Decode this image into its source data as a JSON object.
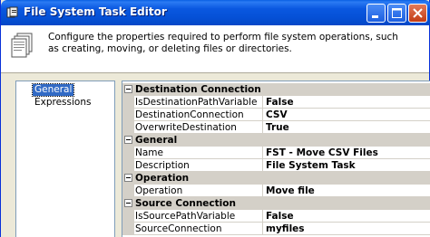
{
  "window": {
    "title": "File System Task Editor",
    "controls": {
      "minimize": "minimize-icon",
      "maximize": "maximize-icon",
      "close": "close-icon"
    }
  },
  "header": {
    "description": "Configure the properties required to perform file system operations, such as creating, moving, or deleting files or directories.",
    "icon": "documents-stack-icon"
  },
  "nav": {
    "items": [
      {
        "label": "General",
        "selected": true
      },
      {
        "label": "Expressions",
        "selected": false
      }
    ]
  },
  "grid": {
    "categories": [
      {
        "label": "Destination Connection",
        "rows": [
          {
            "name": "IsDestinationPathVariable",
            "value": "False"
          },
          {
            "name": "DestinationConnection",
            "value": "CSV"
          },
          {
            "name": "OverwriteDestination",
            "value": "True"
          }
        ]
      },
      {
        "label": "General",
        "rows": [
          {
            "name": "Name",
            "value": "FST - Move CSV Files"
          },
          {
            "name": "Description",
            "value": "File System Task"
          }
        ]
      },
      {
        "label": "Operation",
        "rows": [
          {
            "name": "Operation",
            "value": "Move file"
          }
        ]
      },
      {
        "label": "Source Connection",
        "rows": [
          {
            "name": "IsSourcePathVariable",
            "value": "False"
          },
          {
            "name": "SourceConnection",
            "value": "myfiles"
          }
        ]
      }
    ]
  },
  "colors": {
    "titlebar": "#0a58e0",
    "selection": "#316ac5",
    "category_band": "#d4d0c8"
  }
}
